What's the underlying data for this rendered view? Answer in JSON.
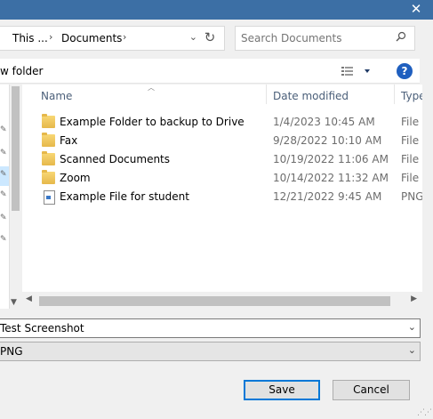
{
  "window": {
    "close_glyph": "✕"
  },
  "address": {
    "crumbs": [
      "This ...",
      "Documents"
    ],
    "separator": "›",
    "dropdown_glyph": "⌄",
    "refresh_glyph": "↻"
  },
  "search": {
    "placeholder": "Search Documents",
    "icon": "search-icon"
  },
  "commandbar": {
    "new_folder_label": "w folder",
    "help_glyph": "?"
  },
  "columns": {
    "name": "Name",
    "date": "Date modified",
    "type": "Type"
  },
  "files": [
    {
      "name": "Example Folder to backup to Drive",
      "date": "1/4/2023 10:45 AM",
      "type": "File fc",
      "icon": "folder-icon"
    },
    {
      "name": "Fax",
      "date": "9/28/2022 10:10 AM",
      "type": "File fc",
      "icon": "folder-icon"
    },
    {
      "name": "Scanned Documents",
      "date": "10/19/2022 11:06 AM",
      "type": "File fc",
      "icon": "folder-icon"
    },
    {
      "name": "Zoom",
      "date": "10/14/2022 11:32 AM",
      "type": "File fc",
      "icon": "folder-icon"
    },
    {
      "name": "Example File for student",
      "date": "12/21/2022 9:45 AM",
      "type": "PNG",
      "icon": "image-file-icon"
    }
  ],
  "form": {
    "file_name": "Test Screenshot",
    "file_type": "PNG"
  },
  "buttons": {
    "save": "Save",
    "cancel": "Cancel"
  },
  "colors": {
    "titlebar": "#3c6fa5",
    "accent": "#0078d7",
    "help": "#1f5fbf",
    "folder": "#f2cc5e"
  }
}
